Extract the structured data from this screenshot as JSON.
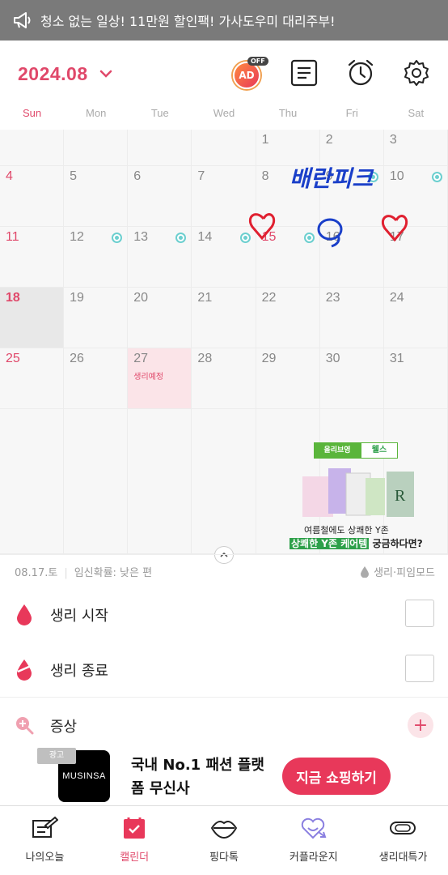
{
  "notice": {
    "text": "청소 없는 일상! 11만원 할인팩! 가사도우미 대리주부!"
  },
  "header": {
    "month": "2024.08",
    "ad_badge": "AD",
    "ad_off": "OFF"
  },
  "weekdays": [
    "Sun",
    "Mon",
    "Tue",
    "Wed",
    "Thu",
    "Fri",
    "Sat"
  ],
  "calendar": {
    "week1": [
      "",
      "",
      "",
      "",
      "1",
      "2",
      "3"
    ],
    "week2": [
      "4",
      "5",
      "6",
      "7",
      "8",
      "9",
      "10"
    ],
    "week3": [
      "11",
      "12",
      "13",
      "14",
      "15",
      "16",
      "17"
    ],
    "week4": [
      "18",
      "19",
      "20",
      "21",
      "22",
      "23",
      "24"
    ],
    "week5": [
      "25",
      "26",
      "27",
      "28",
      "29",
      "30",
      "31"
    ],
    "predicted_tag": "생리예정",
    "handwriting": "배란피크"
  },
  "cal_ad": {
    "logo1": "올리브영",
    "logo2": "웰스",
    "line1": "여름철에도 상쾌한 Y존",
    "line2_hl": "상쾌한 Y존 케어템",
    "line2_rest": " 궁금하다면?"
  },
  "info": {
    "date": "08.17.토",
    "pregnancy": "임신확률: 낮은 편",
    "mode": "생리·피임모드"
  },
  "rows": {
    "start": "생리 시작",
    "end": "생리 종료",
    "symptom": "증상"
  },
  "ad_banner": {
    "label": "광고",
    "brand": "MUSINSA",
    "text": "국내 No.1 패션 플랫폼 무신사",
    "cta": "지금 쇼핑하기"
  },
  "nav": {
    "today": "나의오늘",
    "calendar": "캘린더",
    "talk": "핑다톡",
    "couple": "커플라운지",
    "agency": "생리대특가"
  },
  "colors": {
    "accent": "#e0486a",
    "teal": "#6ccfcf",
    "banner": "#7a7a7a"
  }
}
